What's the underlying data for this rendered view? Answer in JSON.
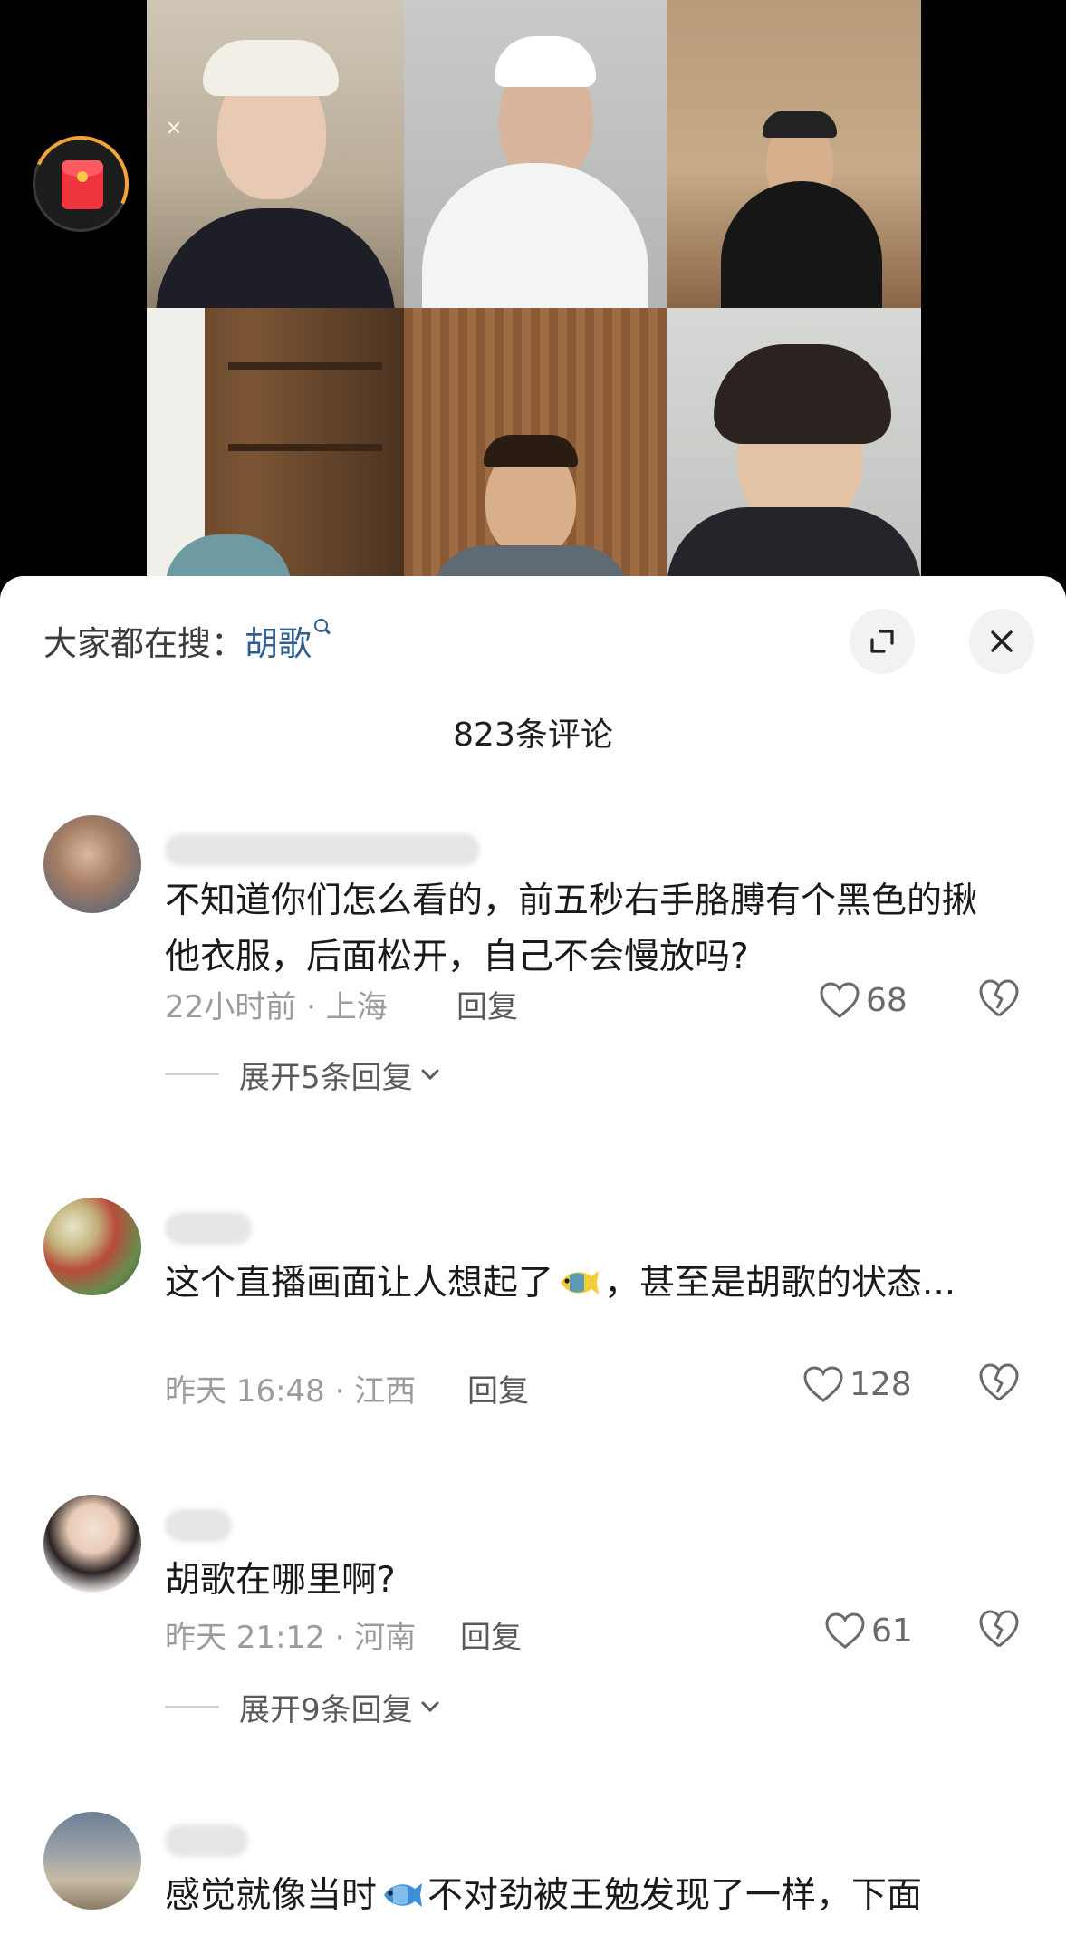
{
  "red_packet": {
    "icon": "red-envelope-icon",
    "close_label": "×"
  },
  "sheet": {
    "trending_prefix": "大家都在搜：",
    "trending_keyword": "胡歌",
    "comment_count": "823条评论"
  },
  "comments": [
    {
      "text": "不知道你们怎么看的，前五秒右手胳膊有个黑色的揪他衣服，后面松开，自己不会慢放吗?",
      "time_location": "22小时前 · 上海",
      "reply_label": "回复",
      "likes": "68",
      "expand_label": "展开5条回复"
    },
    {
      "text_part1": "这个直播画面让人想起了",
      "text_part2": "，甚至是胡歌的状态...",
      "time_location": "昨天 16:48 · 江西",
      "reply_label": "回复",
      "likes": "128"
    },
    {
      "text": "胡歌在哪里啊?",
      "time_location": "昨天 21:12 · 河南",
      "reply_label": "回复",
      "likes": "61",
      "expand_label": "展开9条回复"
    },
    {
      "text_part1": "感觉就像当时",
      "text_part2": "不对劲被王勉发现了一样，下面"
    }
  ],
  "colors": {
    "keyword": "#2f5f92",
    "sheet_bg": "#ffffff",
    "meta_text": "#9c9c9c"
  }
}
